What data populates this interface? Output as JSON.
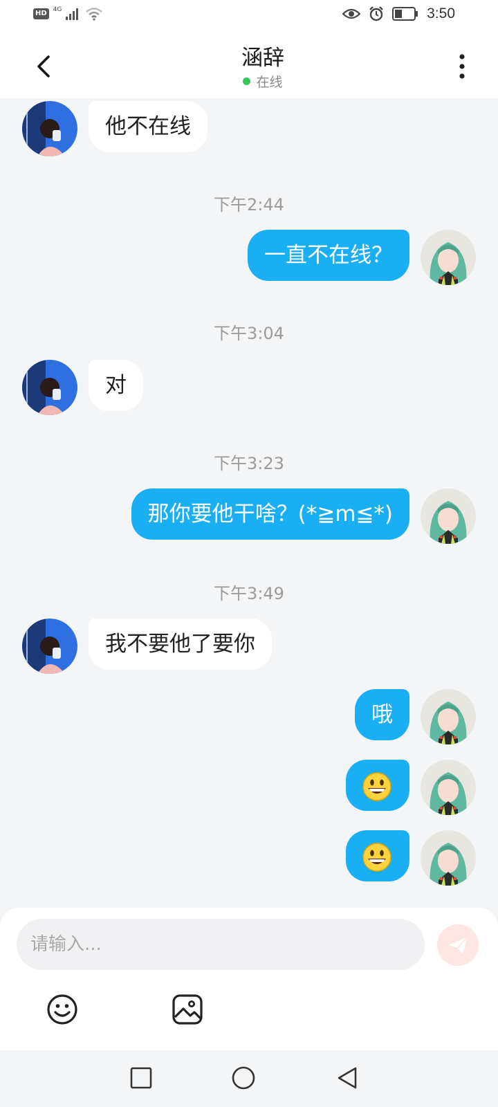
{
  "status_bar": {
    "hd": "HD",
    "network": "4G",
    "time": "3:50"
  },
  "header": {
    "title": "涵辞",
    "presence": "在线",
    "presence_color": "#35c759"
  },
  "colors": {
    "accent": "#1aaff5",
    "background": "#f4f5f7",
    "incoming_bubble": "#ffffff"
  },
  "messages": [
    {
      "side": "in",
      "text": "他不在线"
    },
    {
      "timestamp": "下午2:44"
    },
    {
      "side": "out",
      "text": "一直不在线？"
    },
    {
      "timestamp": "下午3:04"
    },
    {
      "side": "in",
      "text": "对"
    },
    {
      "timestamp": "下午3:23"
    },
    {
      "side": "out",
      "text": "那你要他干啥？(*≧m≦*)"
    },
    {
      "timestamp": "下午3:49"
    },
    {
      "side": "in",
      "text": "我不要他了要你"
    },
    {
      "side": "out",
      "text": "哦"
    },
    {
      "side": "out",
      "emoji": "grinning-face"
    },
    {
      "side": "out",
      "emoji": "grinning-face"
    }
  ],
  "chat": {
    "m1": "他不在线",
    "t1": "下午2:44",
    "m2": "一直不在线？",
    "t2": "下午3:04",
    "m3": "对",
    "t3": "下午3:23",
    "m4": "那你要他干啥？(*≧m≦*)",
    "t4": "下午3:49",
    "m5": "我不要他了要你",
    "m6": "哦"
  },
  "input": {
    "placeholder": "请输入..."
  },
  "icons": {
    "back": "chevron-left-icon",
    "more": "more-vertical-icon",
    "send": "send-icon",
    "emoji_tool": "smiley-icon",
    "image_tool": "image-icon",
    "nav_recents": "square-icon",
    "nav_home": "circle-icon",
    "nav_back": "triangle-back-icon"
  }
}
